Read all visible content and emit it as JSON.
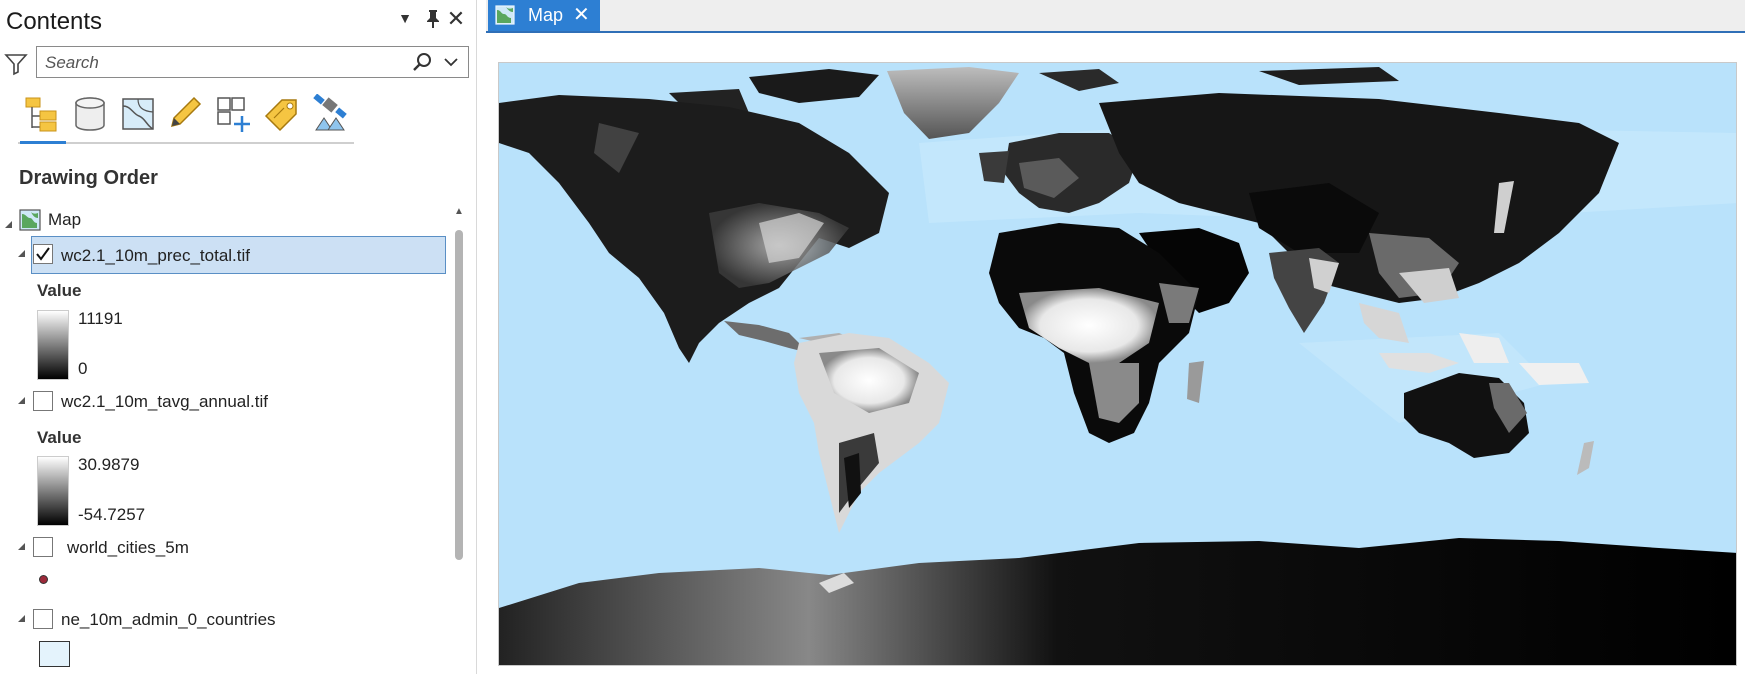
{
  "contents": {
    "title": "Contents",
    "search_placeholder": "Search",
    "section_title": "Drawing Order",
    "toolbar_icons": [
      "list-by-drawing-order-icon",
      "list-by-data-source-icon",
      "list-by-selection-icon",
      "list-by-editing-icon",
      "list-by-snapping-icon",
      "list-by-labeling-icon",
      "list-by-perspective-imagery-icon"
    ],
    "map_node": "Map",
    "layers": [
      {
        "name": "wc2.1_10m_prec_total.tif",
        "checked": true,
        "selected": true,
        "legend_title": "Value",
        "max": "11191",
        "min": "0"
      },
      {
        "name": "wc2.1_10m_tavg_annual.tif",
        "checked": false,
        "selected": false,
        "legend_title": "Value",
        "max": "30.9879",
        "min": "-54.7257"
      },
      {
        "name": "world_cities_5m",
        "checked": false,
        "selected": false,
        "symbol": "point",
        "symbol_color": "#9c2a3a"
      },
      {
        "name": "ne_10m_admin_0_countries",
        "checked": false,
        "selected": false,
        "symbol": "polygon",
        "symbol_color": "#e4f3fc"
      }
    ]
  },
  "map_view": {
    "tab_label": "Map",
    "ocean_color": "#b9e2fb",
    "accent_color": "#2d7fd3"
  }
}
